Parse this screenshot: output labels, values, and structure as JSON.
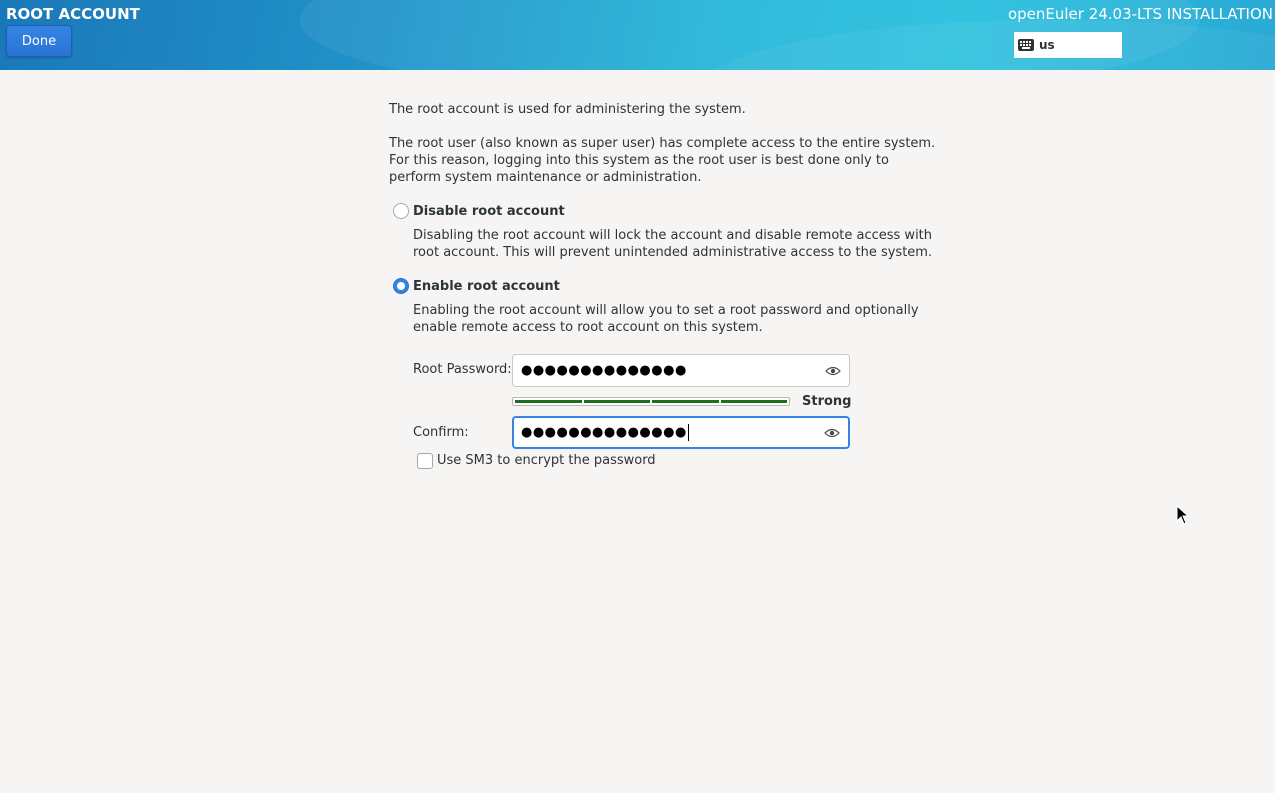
{
  "header": {
    "spoke_title": "ROOT ACCOUNT",
    "done_label": "Done",
    "product_title": "openEuler 24.03-LTS INSTALLATION",
    "keyboard_layout": "us",
    "keyboard_icon": "keyboard-icon"
  },
  "intro": {
    "line1": "The root account is used for administering the system.",
    "line2": "The root user (also known as super user) has complete access to the entire system.\nFor this reason, logging into this system as the root user is best done only to\nperform system maintenance or administration."
  },
  "options": {
    "disable": {
      "label": "Disable root account",
      "description": "Disabling the root account will lock the account and disable remote access with\nroot account. This will prevent unintended administrative access to the system.",
      "checked": false
    },
    "enable": {
      "label": "Enable root account",
      "description": "Enabling the root account will allow you to set a root password and optionally\nenable remote access to root account on this system.",
      "checked": true
    }
  },
  "password": {
    "label": "Root Password:",
    "masked_value": "●●●●●●●●●●●●●●",
    "reveal_icon": "eye-icon"
  },
  "strength": {
    "label": "Strong",
    "level_fraction": 1.0,
    "color": "#1f6e1f"
  },
  "confirm": {
    "label": "Confirm:",
    "masked_value": "●●●●●●●●●●●●●●",
    "reveal_icon": "eye-icon"
  },
  "sm3": {
    "label": "Use SM3 to encrypt the password",
    "checked": false
  },
  "colors": {
    "accent": "#3584e4",
    "background": "#f6f5f4"
  }
}
